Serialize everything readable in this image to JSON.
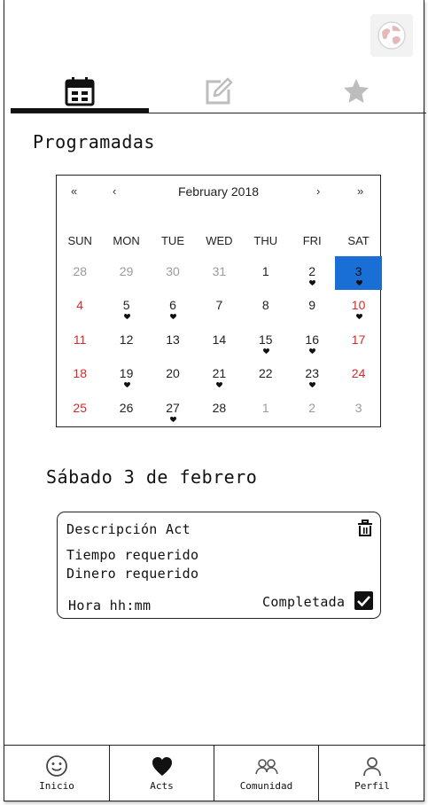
{
  "tabs": [
    {
      "name": "calendar",
      "icon": "calendar-icon",
      "active": true
    },
    {
      "name": "edit",
      "icon": "edit-icon",
      "active": false
    },
    {
      "name": "favorites",
      "icon": "star-icon",
      "active": false
    }
  ],
  "section_title": "Programadas",
  "calendar": {
    "month_label": "February 2018",
    "nav": {
      "prev_year": "«",
      "prev_month": "‹",
      "next_month": "›",
      "next_year": "»"
    },
    "weekdays": [
      "SUN",
      "MON",
      "TUE",
      "WED",
      "THU",
      "FRI",
      "SAT"
    ],
    "weeks": [
      [
        {
          "d": "28",
          "t": "muted"
        },
        {
          "d": "29",
          "t": "muted"
        },
        {
          "d": "30",
          "t": "muted"
        },
        {
          "d": "31",
          "t": "muted"
        },
        {
          "d": "1",
          "t": "normal"
        },
        {
          "d": "2",
          "t": "normal",
          "dot": true
        },
        {
          "d": "3",
          "t": "selected",
          "dot": true
        }
      ],
      [
        {
          "d": "4",
          "t": "weekend"
        },
        {
          "d": "5",
          "t": "normal",
          "dot": true
        },
        {
          "d": "6",
          "t": "normal",
          "dot": true
        },
        {
          "d": "7",
          "t": "normal"
        },
        {
          "d": "8",
          "t": "normal"
        },
        {
          "d": "9",
          "t": "normal"
        },
        {
          "d": "10",
          "t": "weekend",
          "dot": true
        }
      ],
      [
        {
          "d": "11",
          "t": "weekend"
        },
        {
          "d": "12",
          "t": "normal"
        },
        {
          "d": "13",
          "t": "normal"
        },
        {
          "d": "14",
          "t": "normal"
        },
        {
          "d": "15",
          "t": "normal",
          "dot": true
        },
        {
          "d": "16",
          "t": "normal",
          "dot": true
        },
        {
          "d": "17",
          "t": "weekend"
        }
      ],
      [
        {
          "d": "18",
          "t": "weekend"
        },
        {
          "d": "19",
          "t": "normal",
          "dot": true
        },
        {
          "d": "20",
          "t": "normal"
        },
        {
          "d": "21",
          "t": "normal",
          "dot": true
        },
        {
          "d": "22",
          "t": "normal"
        },
        {
          "d": "23",
          "t": "normal",
          "dot": true
        },
        {
          "d": "24",
          "t": "weekend"
        }
      ],
      [
        {
          "d": "25",
          "t": "weekend"
        },
        {
          "d": "26",
          "t": "normal"
        },
        {
          "d": "27",
          "t": "normal",
          "dot": true
        },
        {
          "d": "28",
          "t": "normal"
        },
        {
          "d": "1",
          "t": "muted"
        },
        {
          "d": "2",
          "t": "muted"
        },
        {
          "d": "3",
          "t": "muted"
        }
      ]
    ]
  },
  "date_title": "Sábado 3 de febrero",
  "activity_card": {
    "description": "Descripción Act",
    "time_required": "Tiempo requerido",
    "money_required": "Dinero requerido",
    "time": "Hora hh:mm",
    "completed_label": "Completada",
    "completed": true
  },
  "bottom_nav": [
    {
      "label": "Inicio",
      "icon": "smile-icon",
      "active": false
    },
    {
      "label": "Acts",
      "icon": "heart-icon",
      "active": true
    },
    {
      "label": "Comunidad",
      "icon": "community-icon",
      "active": false
    },
    {
      "label": "Perfil",
      "icon": "user-icon",
      "active": false
    }
  ],
  "colors": {
    "accent": "#1a6fd6",
    "weekend": "#d42a2a",
    "muted": "#9a9a9a",
    "inactive_icon": "#bdbdbd"
  }
}
